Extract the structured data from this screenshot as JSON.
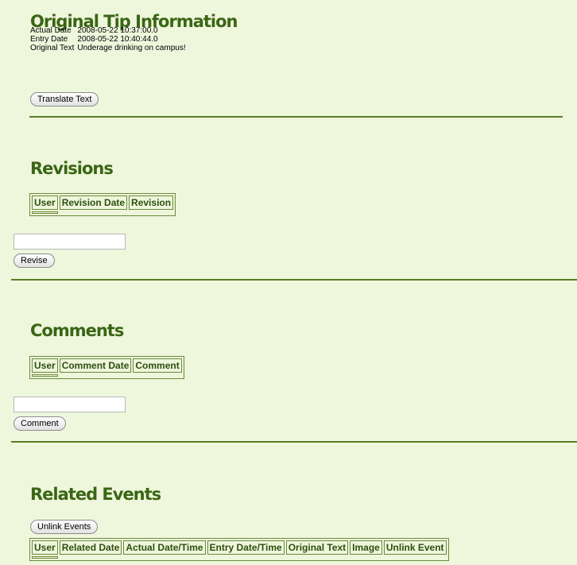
{
  "original_tip": {
    "title": "Original Tip Information",
    "fields": [
      {
        "label": "Actual Date",
        "value": "2008-05-22 10:37:00.0"
      },
      {
        "label": "Entry Date",
        "value": "2008-05-22 10:40:44.0"
      },
      {
        "label": "Original Text",
        "value": "Underage drinking on campus!"
      }
    ],
    "translate_label": "Translate Text"
  },
  "revisions": {
    "title": "Revisions",
    "columns": [
      "User",
      "Revision Date",
      "Revision"
    ],
    "input_value": "",
    "button_label": "Revise"
  },
  "comments": {
    "title": "Comments",
    "columns": [
      "User",
      "Comment Date",
      "Comment"
    ],
    "input_value": "",
    "button_label": "Comment"
  },
  "related_events": {
    "title": "Related Events",
    "unlink_label": "Unlink Events",
    "columns": [
      "User",
      "Related Date",
      "Actual Date/Time",
      "Entry Date/Time",
      "Original Text",
      "Image",
      "Unlink Event"
    ]
  },
  "colors": {
    "background": "#eef6dc",
    "heading": "#3a6614",
    "rule": "#587d24"
  }
}
